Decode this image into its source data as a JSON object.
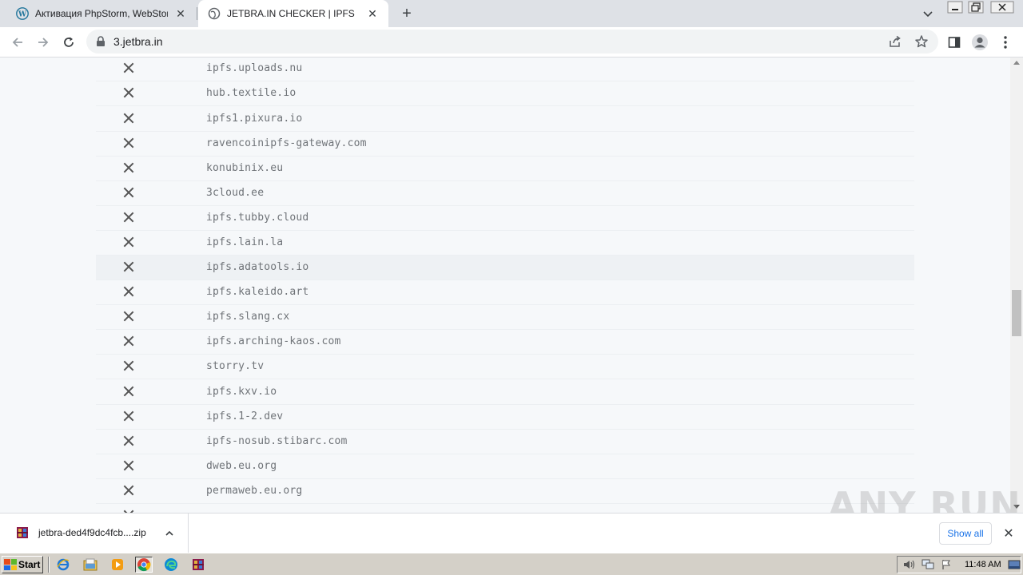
{
  "tabs": [
    {
      "title": "Активация PhpStorm, WebStorm, IntelliJ IDEA",
      "close": "✕",
      "favicon": "wordpress-icon"
    },
    {
      "title": "JETBRA.IN CHECKER | IPFS",
      "close": "✕",
      "favicon": "globe-icon"
    }
  ],
  "newtab_label": "+",
  "address": {
    "url": "3.jetbra.in"
  },
  "rows": [
    {
      "host": "ipfs.uploads.nu",
      "status": "fail"
    },
    {
      "host": "hub.textile.io",
      "status": "fail"
    },
    {
      "host": "ipfs1.pixura.io",
      "status": "fail"
    },
    {
      "host": "ravencoinipfs-gateway.com",
      "status": "fail"
    },
    {
      "host": "konubinix.eu",
      "status": "fail"
    },
    {
      "host": "3cloud.ee",
      "status": "fail"
    },
    {
      "host": "ipfs.tubby.cloud",
      "status": "fail"
    },
    {
      "host": "ipfs.lain.la",
      "status": "fail"
    },
    {
      "host": "ipfs.adatools.io",
      "status": "fail"
    },
    {
      "host": "ipfs.kaleido.art",
      "status": "fail"
    },
    {
      "host": "ipfs.slang.cx",
      "status": "fail"
    },
    {
      "host": "ipfs.arching-kaos.com",
      "status": "fail"
    },
    {
      "host": "storry.tv",
      "status": "fail"
    },
    {
      "host": "ipfs.kxv.io",
      "status": "fail"
    },
    {
      "host": "ipfs.1-2.dev",
      "status": "fail"
    },
    {
      "host": "ipfs-nosub.stibarc.com",
      "status": "fail"
    },
    {
      "host": "dweb.eu.org",
      "status": "fail"
    },
    {
      "host": "permaweb.eu.org",
      "status": "fail"
    }
  ],
  "download": {
    "filename": "jetbra-ded4f9dc4fcb....zip",
    "show_all": "Show all",
    "close": "✕"
  },
  "watermark": "ANY RUN",
  "taskbar": {
    "start": "Start",
    "clock": "11:48 AM"
  },
  "colors": {
    "fail_mark": "#555555",
    "host_text": "#6f7378",
    "link": "#1a73e8"
  }
}
